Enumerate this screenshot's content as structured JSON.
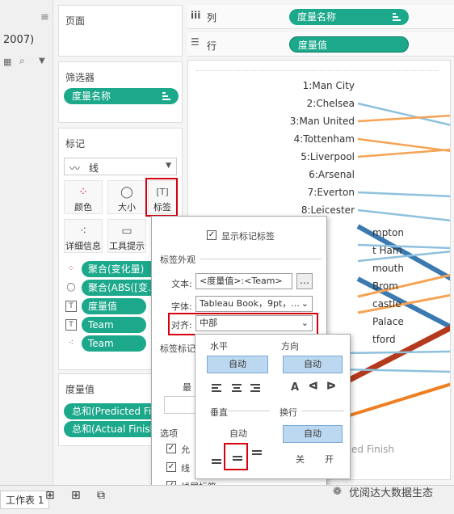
{
  "left_strip": {
    "partial_text": "2007)"
  },
  "pages_panel": {
    "title": "页面"
  },
  "filters_panel": {
    "title": "筛选器",
    "pill": "度量名称"
  },
  "marks_panel": {
    "title": "标记",
    "mark_type": "线",
    "buttons": {
      "color": "颜色",
      "size": "大小",
      "label": "标签",
      "detail": "详细信息",
      "tooltip": "工具提示"
    },
    "rows": [
      {
        "label": "聚合(变化量)"
      },
      {
        "label": "聚合(ABS([变..."
      },
      {
        "label": "度量值"
      },
      {
        "label": "Team"
      },
      {
        "label": "Team"
      }
    ]
  },
  "measures_panel": {
    "title": "度量值",
    "items": [
      "总和(Predicted Fin...",
      "总和(Actual Finish..."
    ]
  },
  "shelves": {
    "columns_label": "列",
    "columns_pill": "度量名称",
    "rows_label": "行",
    "rows_pill": "度量值"
  },
  "chart": {
    "teams": [
      "1:Man City",
      "2:Chelsea",
      "3:Man United",
      "4:Tottenham",
      "5:Liverpool",
      "6:Arsenal",
      "7:Everton",
      "8:Leicester"
    ],
    "partial_labels": [
      "mpton",
      "t Ham",
      "mouth",
      "Brom",
      "castle",
      "Palace",
      "tford"
    ],
    "bottom_label": "ed Finish"
  },
  "popup": {
    "show_labels": "显示标记标签",
    "appearance": "标签外观",
    "text_label": "文本:",
    "text_value": "<度量值>:<Team>",
    "font_label": "字体:",
    "font_value": "Tableau Book，9pt，...",
    "align_label": "对齐:",
    "align_value": "中部",
    "marks_section": "标签标记",
    "min_label": "最",
    "options": "选项",
    "opt1": "允",
    "opt2": "线",
    "opt3": "线尾标签"
  },
  "align_dropdown": {
    "horizontal": "水平",
    "direction": "方向",
    "auto1": "自动",
    "auto2": "自动",
    "vertical": "垂直",
    "wrap": "换行",
    "vertical_auto": "自动",
    "wrap_auto": "自动",
    "off": "关",
    "on": "开",
    "dir_a": "A"
  },
  "footer": {
    "sheet_tab": "工作表 1",
    "watermark": "优阅达大数据生态"
  },
  "colors": {
    "pill_green": "#1ba88b",
    "highlight_red": "#d7000f",
    "auto_button": "#bcd8f0"
  }
}
